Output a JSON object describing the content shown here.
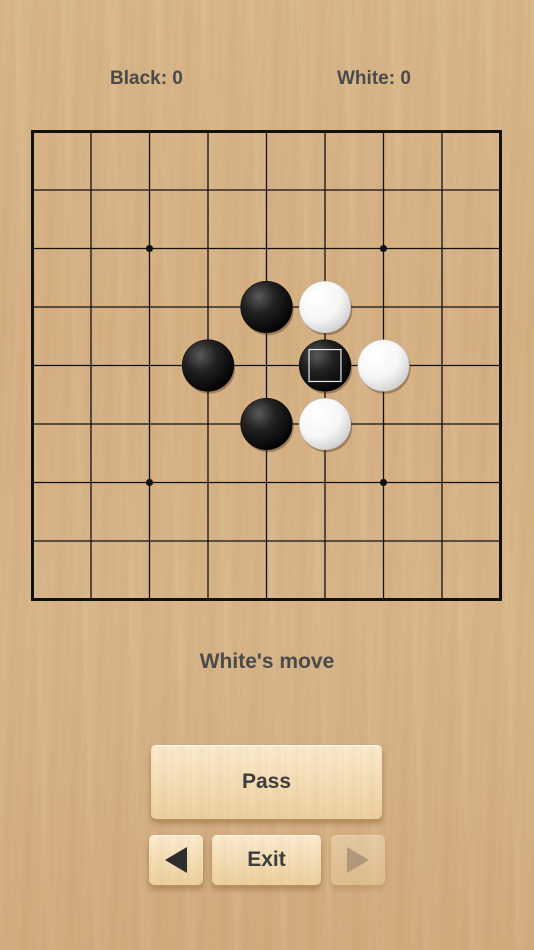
{
  "scores": {
    "black_label": "Black: 0",
    "white_label": "White: 0"
  },
  "board": {
    "size": 9,
    "star_points": [
      [
        2,
        2
      ],
      [
        6,
        2
      ],
      [
        2,
        6
      ],
      [
        6,
        6
      ]
    ],
    "stones": [
      {
        "col": 4,
        "row": 3,
        "color": "black"
      },
      {
        "col": 5,
        "row": 3,
        "color": "white"
      },
      {
        "col": 3,
        "row": 4,
        "color": "black"
      },
      {
        "col": 5,
        "row": 4,
        "color": "black",
        "last_move": true
      },
      {
        "col": 6,
        "row": 4,
        "color": "white"
      },
      {
        "col": 4,
        "row": 5,
        "color": "black"
      },
      {
        "col": 5,
        "row": 5,
        "color": "white"
      }
    ],
    "line_color": "#111111"
  },
  "status": {
    "text": "White's move"
  },
  "buttons": {
    "pass_label": "Pass",
    "exit_label": "Exit",
    "prev_icon": "triangle-left-icon",
    "next_icon": "triangle-right-icon",
    "next_enabled": false
  }
}
